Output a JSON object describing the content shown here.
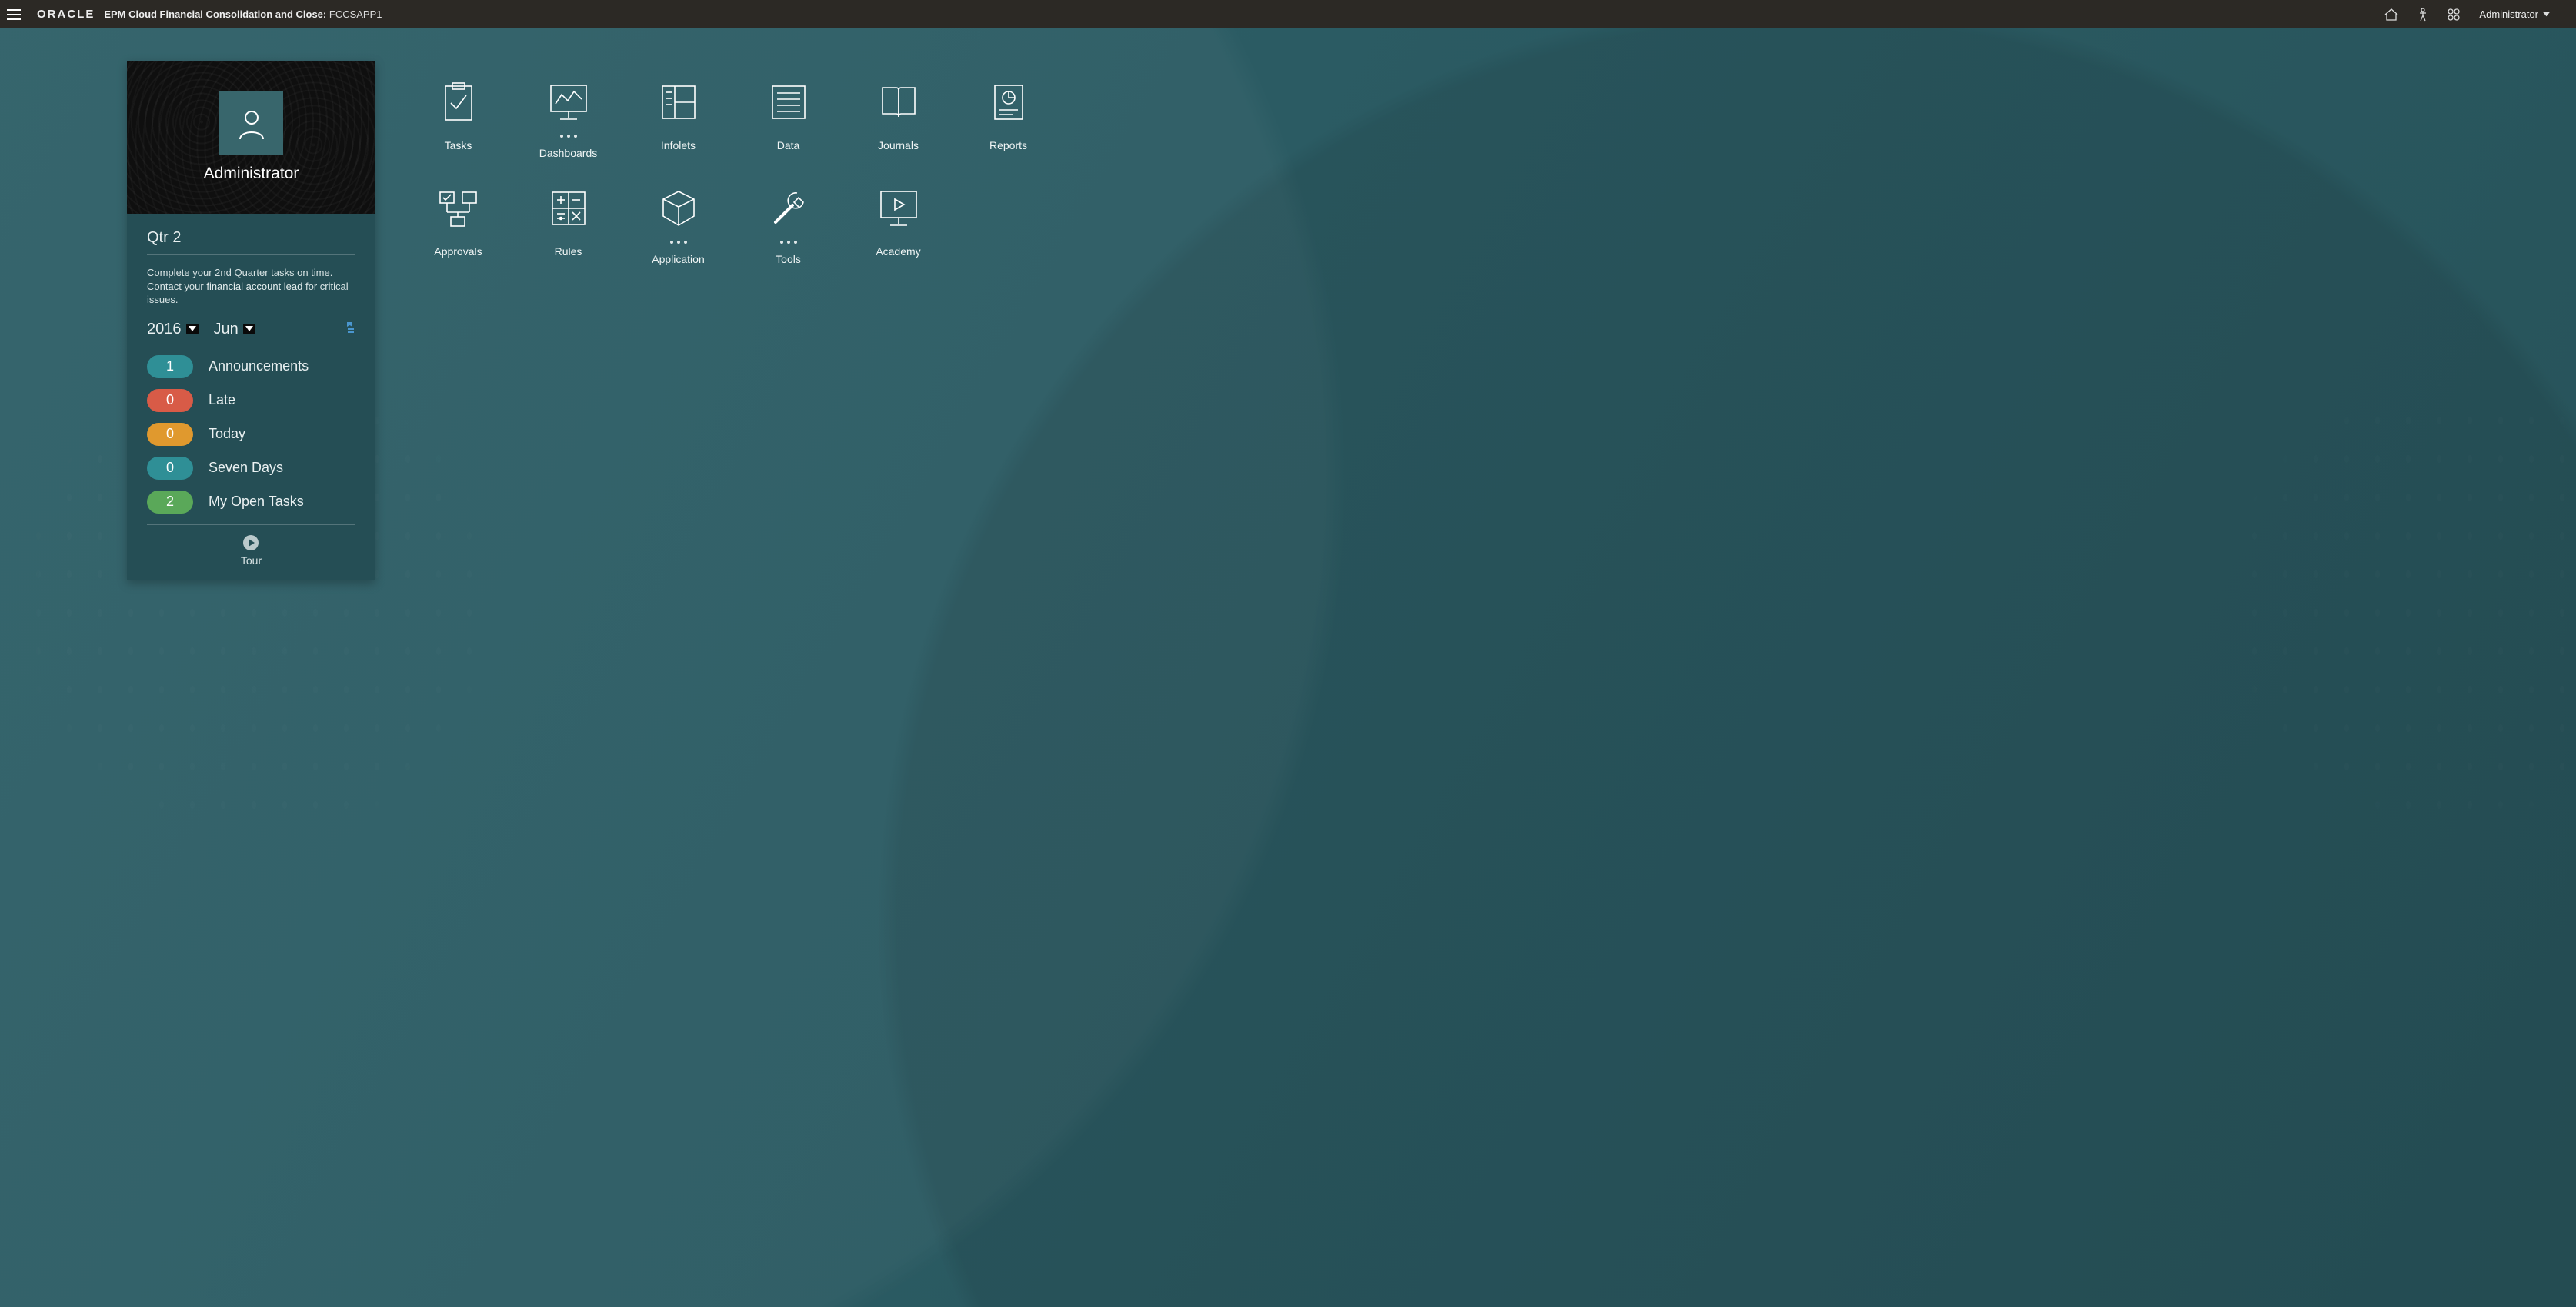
{
  "header": {
    "brand": "ORACLE",
    "title_bold": "EPM Cloud Financial Consolidation and Close:",
    "title_instance": "FCCSAPP1",
    "user_label": "Administrator"
  },
  "card": {
    "username": "Administrator",
    "quarter_title": "Qtr 2",
    "instruction_pre": "Complete your 2nd Quarter tasks on time. Contact your ",
    "instruction_link": "financial account lead",
    "instruction_post": " for critical issues.",
    "year": "2016",
    "month": "Jun",
    "stats": [
      {
        "count": "1",
        "label": "Announcements",
        "color": "teal"
      },
      {
        "count": "0",
        "label": "Late",
        "color": "red"
      },
      {
        "count": "0",
        "label": "Today",
        "color": "orange"
      },
      {
        "count": "0",
        "label": "Seven Days",
        "color": "teal"
      },
      {
        "count": "2",
        "label": "My Open Tasks",
        "color": "green"
      }
    ],
    "tour_label": "Tour"
  },
  "tiles": [
    {
      "label": "Tasks",
      "icon": "tasks",
      "dots": false
    },
    {
      "label": "Dashboards",
      "icon": "dashboards",
      "dots": true
    },
    {
      "label": "Infolets",
      "icon": "infolets",
      "dots": false
    },
    {
      "label": "Data",
      "icon": "data",
      "dots": false
    },
    {
      "label": "Journals",
      "icon": "journals",
      "dots": false
    },
    {
      "label": "Reports",
      "icon": "reports",
      "dots": false
    },
    {
      "label": "Approvals",
      "icon": "approvals",
      "dots": false
    },
    {
      "label": "Rules",
      "icon": "rules",
      "dots": false
    },
    {
      "label": "Application",
      "icon": "application",
      "dots": true
    },
    {
      "label": "Tools",
      "icon": "tools",
      "dots": true
    },
    {
      "label": "Academy",
      "icon": "academy",
      "dots": false
    }
  ]
}
